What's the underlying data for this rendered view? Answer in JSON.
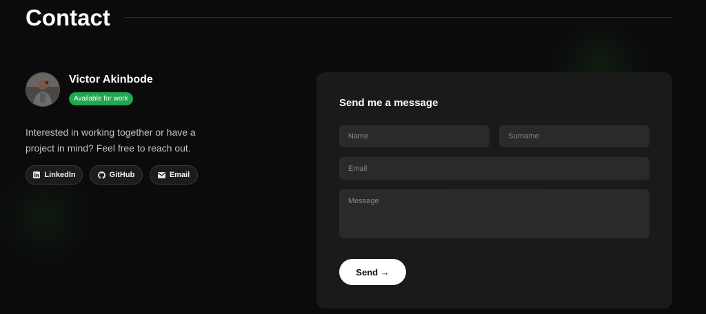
{
  "header": {
    "title": "Contact"
  },
  "profile": {
    "name": "Victor Akinbode",
    "status": "Available for work",
    "status_color": "#1fa84f",
    "avatar_icon": "profile-photo",
    "intro": "Interested in working together or have a project in mind? Feel free to reach out."
  },
  "social": [
    {
      "label": "LinkedIn",
      "icon": "linkedin-icon"
    },
    {
      "label": "GitHub",
      "icon": "github-icon"
    },
    {
      "label": "Email",
      "icon": "mail-icon"
    }
  ],
  "form": {
    "title": "Send me a message",
    "name_placeholder": "Name",
    "surname_placeholder": "Surname",
    "email_placeholder": "Email",
    "message_placeholder": "Message",
    "send_label": "Send →"
  },
  "colors": {
    "background": "#0b0b0b",
    "card": "#1c1c1c",
    "field": "#2a2a2a",
    "accent_green": "#1fa84f"
  }
}
